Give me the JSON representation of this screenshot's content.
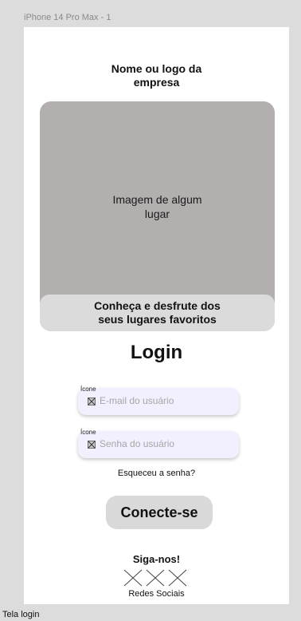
{
  "frame": {
    "name": "iPhone 14 Pro Max - 1"
  },
  "header": {
    "company_line1": "Nome ou logo da",
    "company_line2": "empresa"
  },
  "hero": {
    "image_line1": "Imagem de algum",
    "image_line2": "lugar",
    "caption_line1": "Conheça e desfrute dos",
    "caption_line2": "seus lugares favoritos"
  },
  "login": {
    "title": "Login",
    "email_icon_label": "Ícone",
    "email_placeholder": "E-mail do usuário",
    "password_icon_label": "Ícone",
    "password_placeholder": "Senha do usuário",
    "forgot": "Esqueceu a senha?",
    "connect": "Conecte-se"
  },
  "social": {
    "title": "Siga-nos!",
    "label": "Redes Sociais",
    "icons": [
      "social-placeholder-icon",
      "social-placeholder-icon",
      "social-placeholder-icon"
    ]
  },
  "footer": {
    "screen_label": "Tela login"
  }
}
